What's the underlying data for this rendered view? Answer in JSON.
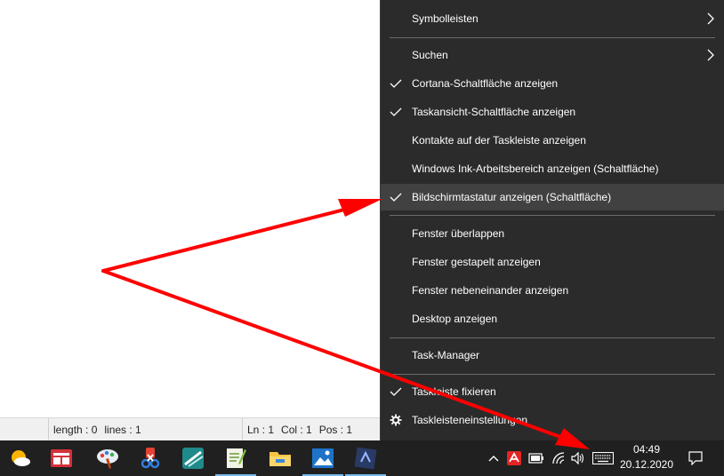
{
  "statusbar": {
    "length": "length : 0",
    "lines": "lines : 1",
    "ln": "Ln : 1",
    "col": "Col : 1",
    "pos": "Pos : 1"
  },
  "menu": {
    "items": [
      {
        "label": "Symbolleisten",
        "checked": false,
        "submenu": true
      },
      {
        "label": "Suchen",
        "checked": false,
        "submenu": true
      },
      {
        "label": "Cortana-Schaltfläche anzeigen",
        "checked": true
      },
      {
        "label": "Taskansicht-Schaltfläche anzeigen",
        "checked": true
      },
      {
        "label": "Kontakte auf der Taskleiste anzeigen",
        "checked": false
      },
      {
        "label": "Windows Ink-Arbeitsbereich anzeigen (Schaltfläche)",
        "checked": false
      },
      {
        "label": "Bildschirmtastatur anzeigen (Schaltfläche)",
        "checked": true,
        "highlighted": true
      },
      {
        "label": "Fenster überlappen",
        "checked": false
      },
      {
        "label": "Fenster gestapelt anzeigen",
        "checked": false
      },
      {
        "label": "Fenster nebeneinander anzeigen",
        "checked": false
      },
      {
        "label": "Desktop anzeigen",
        "checked": false
      },
      {
        "label": "Task-Manager",
        "checked": false
      },
      {
        "label": "Taskleiste fixieren",
        "checked": true
      },
      {
        "label": "Taskleisteneinstellungen",
        "checked": false,
        "icon": "gear-icon"
      }
    ]
  },
  "taskbar": {
    "apps": [
      "weather-app-icon",
      "news-app-icon",
      "paint-app-icon",
      "snipping-tool-icon",
      "road-app-icon",
      "notepad-plus-icon",
      "file-explorer-icon",
      "photos-app-icon",
      "render-app-icon"
    ],
    "tray": [
      "chevron-up-icon",
      "antivirus-icon",
      "battery-icon",
      "wifi-icon",
      "volume-icon",
      "touch-keyboard-icon"
    ],
    "time": "04:49",
    "date": "20.12.2020"
  },
  "colors": {
    "menu_bg": "#2b2b2b",
    "menu_highlight": "#414141",
    "taskbar_bg": "#202020",
    "annotation": "#ff0000",
    "active_indicator": "#76b9ed"
  }
}
